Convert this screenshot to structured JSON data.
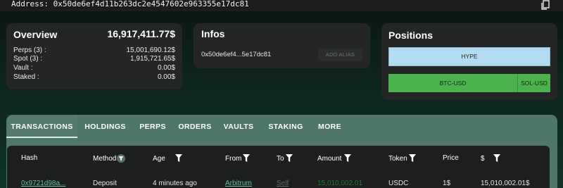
{
  "header": {
    "address": "Address: 0x50de6ef4d11b263dc2e4547602e963355e17dc81"
  },
  "overview": {
    "title": "Overview",
    "total": "16,917,411.77$",
    "rows": [
      {
        "label": "Perps (3) :",
        "value": "15,001,690.12$"
      },
      {
        "label": "Spot (3) :",
        "value": "1,915,721.65$"
      },
      {
        "label": "Vault :",
        "value": "0.00$"
      },
      {
        "label": "Staked :",
        "value": "0.00$"
      }
    ]
  },
  "infos": {
    "title": "Infos",
    "address_short": "0x50de6ef4...5e17dc81",
    "alias_button": "ADD ALIAS"
  },
  "positions": {
    "title": "Positions",
    "items": [
      "HYPE",
      "BTC-USD",
      "SOL-USD"
    ],
    "hype_color": "#b3dcf2",
    "long_color": "#4bb34d"
  },
  "tabs": [
    "TRANSACTIONS",
    "HOLDINGS",
    "PERPS",
    "ORDERS",
    "VAULTS",
    "STAKING",
    "MORE"
  ],
  "table": {
    "headers": [
      "Hash",
      "Method",
      "Age",
      "From",
      "To",
      "Amount",
      "Token",
      "Price",
      "$"
    ],
    "rows": [
      {
        "hash": "0x9721d98a...",
        "method": "Deposit",
        "age": "4 minutes ago",
        "from": "Arbitrum",
        "to": "Self",
        "amount": "15,010,002.01",
        "token": "USDC",
        "price": "1$",
        "usd": "15,010,002.01$"
      }
    ]
  }
}
